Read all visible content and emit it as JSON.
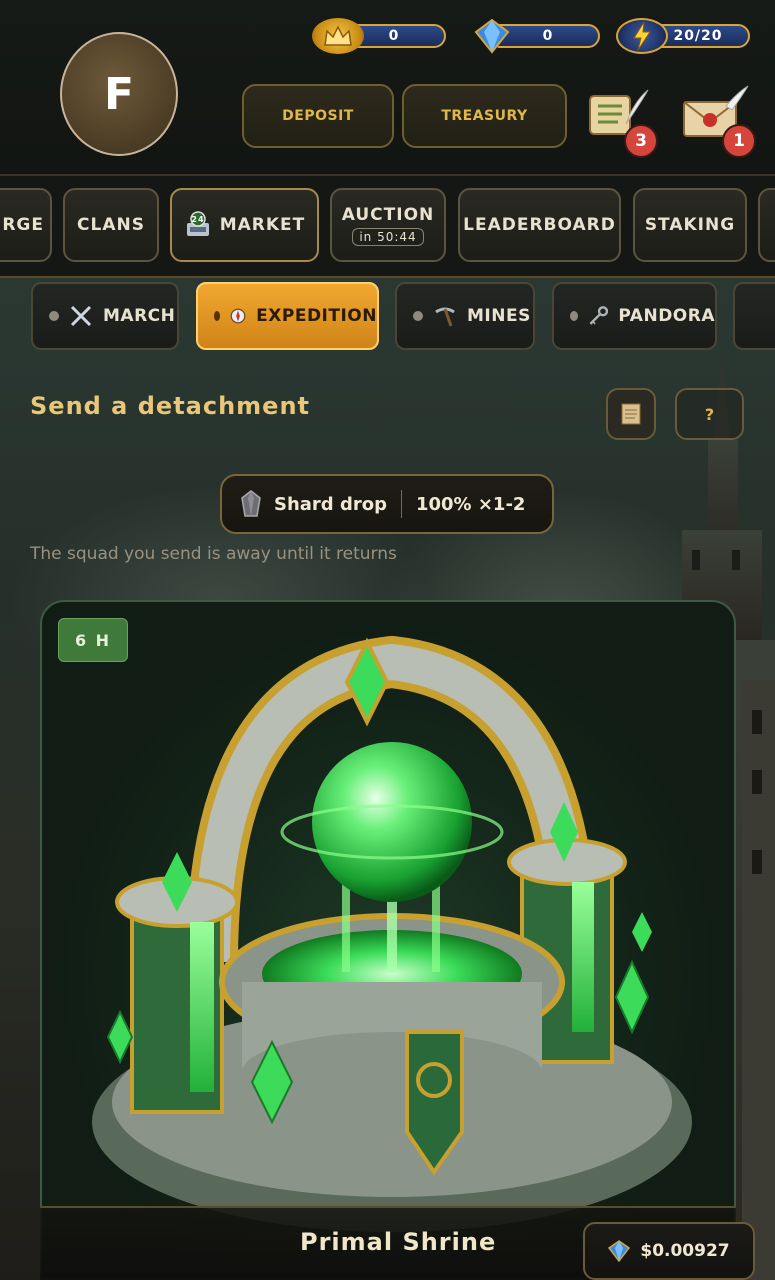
{
  "header": {
    "avatar_letter": "F",
    "resources": [
      {
        "icon": "crown-icon",
        "value": "0"
      },
      {
        "icon": "gem-icon",
        "value": "0"
      },
      {
        "icon": "lightning-icon",
        "value": "20/20"
      }
    ],
    "deposit_label": "DEPOSIT",
    "treasury_label": "TREASURY",
    "quests_badge": "3",
    "mail_badge": "1"
  },
  "nav": {
    "items": [
      {
        "label": "RGE"
      },
      {
        "label": "CLANS"
      },
      {
        "label": "MARKET",
        "icon_text": "24"
      },
      {
        "label": "AUCTION",
        "sub": "in 50:44"
      },
      {
        "label": "LEADERBOARD"
      },
      {
        "label": "STAKING"
      }
    ]
  },
  "tabs": [
    {
      "label": "MARCH",
      "icon": "swords-icon"
    },
    {
      "label": "EXPEDITION",
      "icon": "compass-icon"
    },
    {
      "label": "MINES",
      "icon": "pickaxe-icon"
    },
    {
      "label": "PANDORA",
      "icon": "key-icon"
    }
  ],
  "section": {
    "title": "Send a detachment",
    "help_label": "?",
    "shard_label": "Shard drop",
    "shard_value": "100% ×1-2",
    "note": "The squad you send is away until it returns"
  },
  "card": {
    "duration": "6 H",
    "name": "Primal Shrine",
    "price": "$0.00927"
  },
  "colors": {
    "accent": "#e0b84a",
    "active_tab": "#f0a830",
    "badge": "#d6453c",
    "emerald": "#3cdc5a"
  }
}
